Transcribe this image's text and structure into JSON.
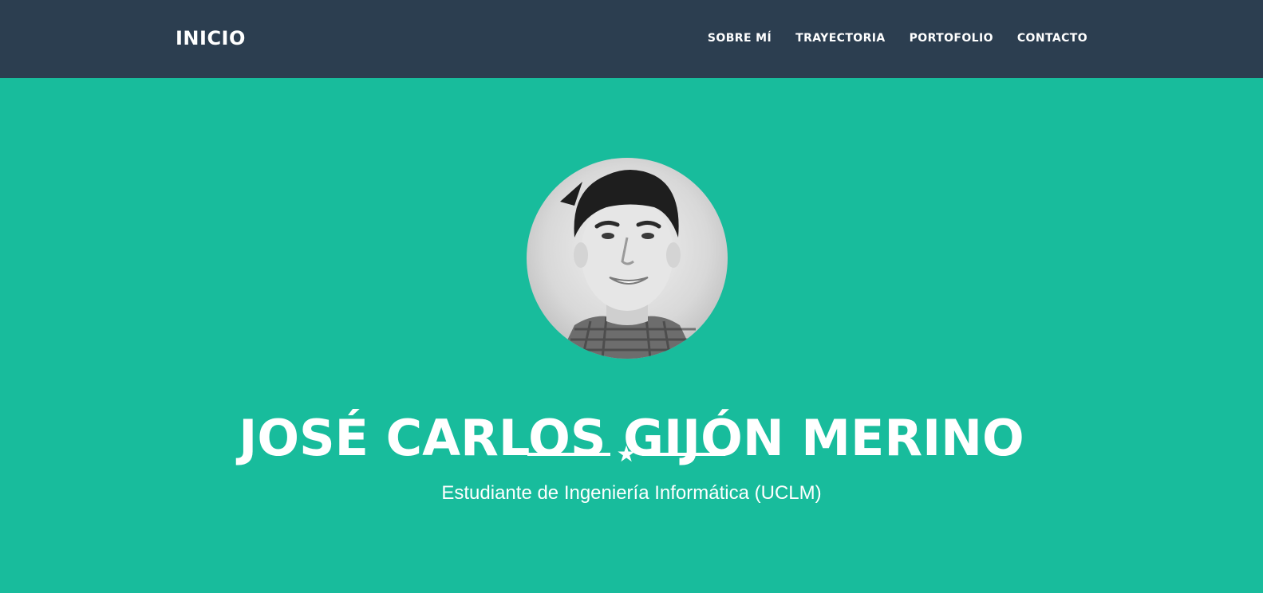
{
  "navbar": {
    "brand": "INICIO",
    "items": [
      {
        "label": "SOBRE MÍ"
      },
      {
        "label": "TRAYECTORIA"
      },
      {
        "label": "PORTOFOLIO"
      },
      {
        "label": "CONTACTO"
      }
    ]
  },
  "hero": {
    "avatar_icon": "profile-photo",
    "name": "JOSÉ CARLOS GIJÓN MERINO",
    "divider_icon": "star-icon",
    "subtitle": "Estudiante de Ingeniería Informática (UCLM)"
  },
  "colors": {
    "navbar_bg": "#2c3e50",
    "hero_bg": "#18bc9c",
    "text": "#ffffff"
  }
}
